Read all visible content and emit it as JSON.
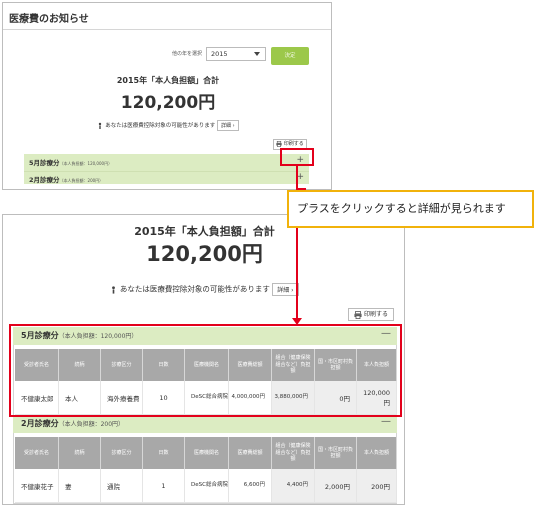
{
  "top": {
    "title": "医療費のお知らせ",
    "year_label": "他の年を選択",
    "year_value": "2015",
    "apply_label": "決定",
    "total_title": "2015年「本人負担額」合計",
    "amount": "120,200円",
    "note": "あなたは医療費控除対象の可能性があります",
    "detail_label": "詳細",
    "print_label": "印刷する",
    "rows": [
      {
        "title": "5月診療分",
        "sub": "（本人負担額：120,000円）",
        "mark": "+"
      },
      {
        "title": "2月診療分",
        "sub": "（本人負担額：200円）",
        "mark": "+"
      }
    ]
  },
  "callout": "プラスをクリックすると詳細が見られます",
  "bottom": {
    "total_title": "2015年「本人負担額」合計",
    "amount": "120,200円",
    "note": "あなたは医療費控除対象の可能性があります",
    "detail_label": "詳細",
    "print_label": "印刷する",
    "headers": [
      "受診者氏名",
      "続柄",
      "診療区分",
      "日数",
      "医療機関名",
      "医療費総額",
      "組合（健康保険組合など）負担額",
      "国・市区町村負担額",
      "本人負担額"
    ],
    "sections": [
      {
        "title": "5月診療分",
        "sub": "（本人負担額：120,000円）",
        "mark": "—",
        "row": [
          "不健康太郎",
          "本人",
          "海外療養費",
          "10",
          "DeSC総合病院",
          "4,000,000円",
          "3,880,000円",
          "0円",
          "120,000円"
        ]
      },
      {
        "title": "2月診療分",
        "sub": "（本人負担額：200円）",
        "mark": "—",
        "row": [
          "不健康花子",
          "妻",
          "通院",
          "1",
          "DeSC総合病院",
          "6,600円",
          "4,400円",
          "2,000円",
          "200円"
        ]
      }
    ]
  },
  "colors": {
    "accent_red": "#e3001b",
    "callout_border": "#f1b20b",
    "section_green": "#dcecc2",
    "apply_green": "#9cc84a"
  },
  "icons": [
    "plus-icon",
    "minus-icon",
    "printer-icon",
    "info-icon",
    "chevron-right-icon",
    "caret-down-icon"
  ]
}
